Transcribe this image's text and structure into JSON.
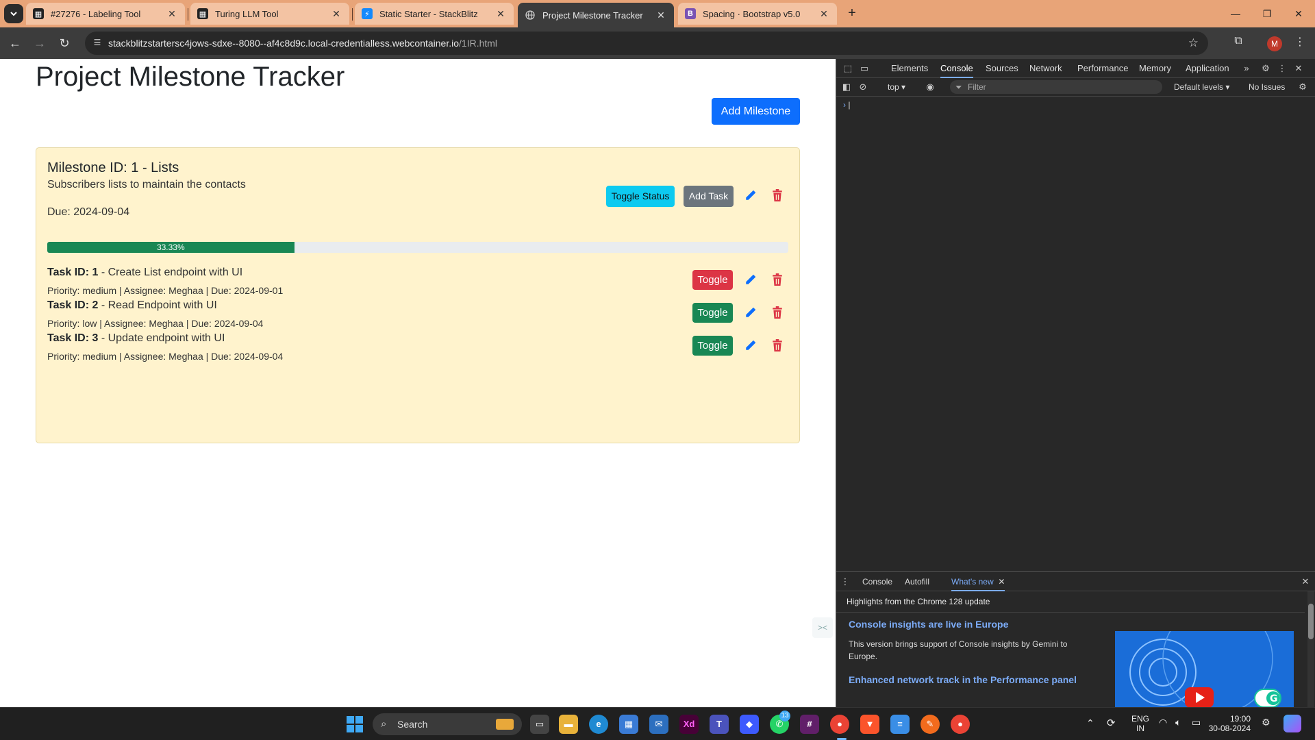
{
  "browser": {
    "tabs": [
      {
        "title": "#27276 - Labeling Tool",
        "icon": "labeling-tool-icon"
      },
      {
        "title": "Turing LLM Tool",
        "icon": "turing-icon"
      },
      {
        "title": "Static Starter - StackBlitz",
        "icon": "stackblitz-icon"
      },
      {
        "title": "Project Milestone Tracker",
        "icon": "globe-icon"
      },
      {
        "title": "Spacing · Bootstrap v5.0",
        "icon": "bootstrap-icon"
      }
    ],
    "active_tab": 3,
    "url_host": "stackblitzstartersc4jows-sdxe--8080--af4c8d9c.local-credentialless.webcontainer.io",
    "url_path": "/1IR.html",
    "profile_initial": "M"
  },
  "app": {
    "title": "Project Milestone Tracker",
    "add_milestone_label": "Add Milestone",
    "milestone": {
      "title": "Milestone ID: 1 - Lists",
      "description": "Subscribers lists to maintain the contacts",
      "due": "Due: 2024-09-04",
      "toggle_status_label": "Toggle Status",
      "add_task_label": "Add Task",
      "progress": 33.33,
      "progress_label": "33.33%",
      "tasks": [
        {
          "id_label": "Task ID: 1",
          "name": " - Create List endpoint with UI",
          "meta": "Priority: medium | Assignee: Meghaa | Due: 2024-09-01",
          "toggle_label": "Toggle",
          "toggle_color": "#dc3545"
        },
        {
          "id_label": "Task ID: 2",
          "name": " - Read Endpoint with UI",
          "meta": "Priority: low | Assignee: Meghaa | Due: 2024-09-04",
          "toggle_label": "Toggle",
          "toggle_color": "#198754"
        },
        {
          "id_label": "Task ID: 3",
          "name": " - Update endpoint with UI",
          "meta": "Priority: medium | Assignee: Meghaa | Due: 2024-09-04",
          "toggle_label": "Toggle",
          "toggle_color": "#198754"
        }
      ]
    }
  },
  "devtools": {
    "tabs": [
      "Elements",
      "Console",
      "Sources",
      "Network",
      "Performance",
      "Memory",
      "Application"
    ],
    "active_tab": "Console",
    "context": "top",
    "filter_placeholder": "Filter",
    "levels": "Default levels",
    "issues": "No Issues",
    "drawer": {
      "tabs": [
        "Console",
        "Autofill",
        "What's new"
      ],
      "active_tab": "What's new",
      "subtitle": "Highlights from the Chrome 128 update",
      "item1_title": "Console insights are live in Europe",
      "item1_text": "This version brings support of Console insights by Gemini to Europe.",
      "item2_title": "Enhanced network track in the Performance panel"
    }
  },
  "taskbar": {
    "search_label": "Search",
    "language_top": "ENG",
    "language_bottom": "IN",
    "time": "19:00",
    "date": "30-08-2024",
    "whatsapp_badge": "13"
  },
  "colors": {
    "tabstrip": "#e8a478",
    "primary": "#0d6efd",
    "info": "#0dcaf0",
    "secondary": "#6c757d",
    "danger": "#dc3545",
    "success": "#198754",
    "card_bg": "#fff3cd"
  }
}
